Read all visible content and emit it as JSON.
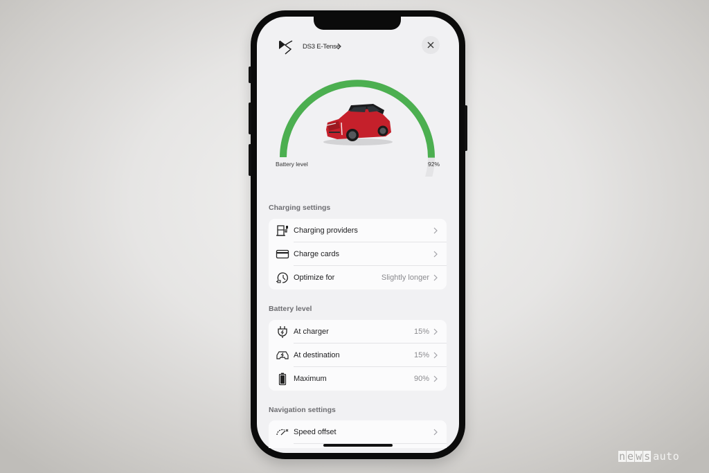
{
  "header": {
    "brand_logo": "ds-logo",
    "title": "DS3 E-Tense",
    "title_chevron": "chevron-right-icon",
    "close_icon": "close-icon"
  },
  "battery_gauge": {
    "label": "Battery level",
    "value_text": "92%",
    "level_fraction": 0.92,
    "color": "#4caf50",
    "track_color": "#e4e4e6",
    "image": "red DS3 E-Tense car"
  },
  "sections": [
    {
      "title": "Charging settings",
      "items": [
        {
          "icon": "charging-station-icon",
          "label": "Charging providers",
          "value": ""
        },
        {
          "icon": "credit-card-icon",
          "label": "Charge cards",
          "value": ""
        },
        {
          "icon": "clock-plug-icon",
          "label": "Optimize for",
          "value": "Slightly longer"
        }
      ]
    },
    {
      "title": "Battery level",
      "items": [
        {
          "icon": "plug-icon",
          "label": "At charger",
          "value": "15%"
        },
        {
          "icon": "car-charge-icon",
          "label": "At destination",
          "value": "15%"
        },
        {
          "icon": "battery-full-icon",
          "label": "Maximum",
          "value": "90%"
        }
      ]
    },
    {
      "title": "Navigation settings",
      "items": [
        {
          "icon": "speedometer-icon",
          "label": "Speed offset",
          "value": ""
        }
      ]
    }
  ],
  "watermark": {
    "boxed": [
      "n",
      "e",
      "w",
      "s"
    ],
    "plain": "auto"
  }
}
